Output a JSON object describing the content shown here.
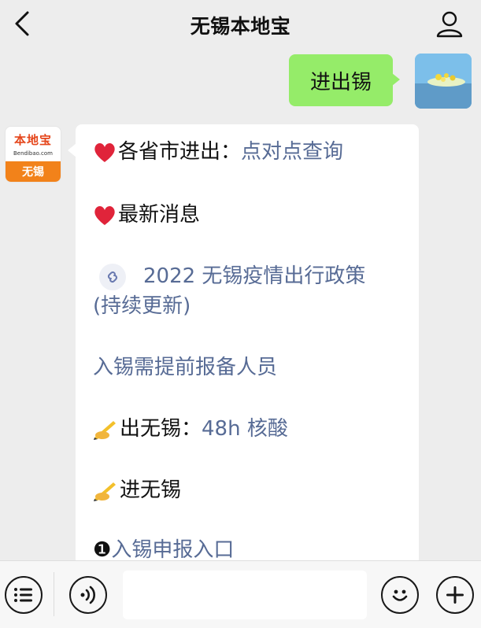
{
  "header": {
    "title": "无锡本地宝",
    "back_icon": "chevron-left-icon",
    "profile_icon": "user-icon"
  },
  "outgoing": {
    "text": "进出锡"
  },
  "bot_avatar": {
    "logo_text": "本地宝",
    "logo_sub": "Bendibao.com",
    "logo_city": "无锡"
  },
  "message": {
    "line1_label": "各省市进出：",
    "line1_link": "点对点查询",
    "line2_label": "最新消息",
    "line3_link": "2022 无锡疫情出行政策",
    "line3_link_cont": "(持续更新)",
    "line4_link": "入锡需提前报备人员",
    "line5_label": "出无锡：",
    "line5_link": "48h 核酸",
    "line6_label": "进无锡",
    "line7_num": "❶",
    "line7_link": "入锡申报入口"
  },
  "bottom_bar": {
    "menu_icon": "menu-icon",
    "voice_icon": "voice-icon",
    "emoji_icon": "emoji-icon",
    "plus_icon": "plus-icon"
  },
  "colors": {
    "link": "#576b95",
    "outgoing_bubble": "#95ec69",
    "heart": "#e0243a"
  }
}
